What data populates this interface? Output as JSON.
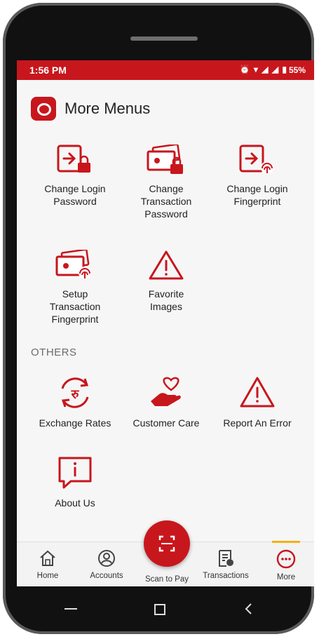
{
  "status_bar": {
    "time": "1:56 PM",
    "icons": "⏰ ▾ ◢ ◢ ▮",
    "battery": "55%"
  },
  "header": {
    "title": "More Menus",
    "logo": "bank-logo"
  },
  "menu_items": [
    {
      "label": "Change Login\nPassword",
      "icon": "login-lock-icon"
    },
    {
      "label": "Change\nTransaction\nPassword",
      "icon": "card-lock-icon"
    },
    {
      "label": "Change Login\nFingerprint",
      "icon": "login-fingerprint-icon"
    },
    {
      "label": "Setup\nTransaction\nFingerprint",
      "icon": "card-fingerprint-icon"
    },
    {
      "label": "Favorite\nImages",
      "icon": "warning-icon"
    }
  ],
  "others": {
    "heading": "OTHERS",
    "items": [
      {
        "label": "Exchange Rates",
        "icon": "exchange-icon"
      },
      {
        "label": "Customer Care",
        "icon": "heart-hand-icon"
      },
      {
        "label": "Report An Error",
        "icon": "warning-icon"
      },
      {
        "label": "About Us",
        "icon": "info-icon"
      }
    ]
  },
  "bottom_nav": {
    "items": [
      {
        "label": "Home",
        "icon": "home-icon"
      },
      {
        "label": "Accounts",
        "icon": "account-icon"
      },
      {
        "label": "Transactions",
        "icon": "transactions-icon"
      },
      {
        "label": "More",
        "icon": "more-icon"
      }
    ],
    "scan": {
      "label": "Scan to Pay",
      "icon": "scan-icon"
    },
    "active": "More"
  },
  "colors": {
    "accent": "#c8161d",
    "active_indicator": "#f2b20f",
    "background": "#f6f6f6"
  }
}
